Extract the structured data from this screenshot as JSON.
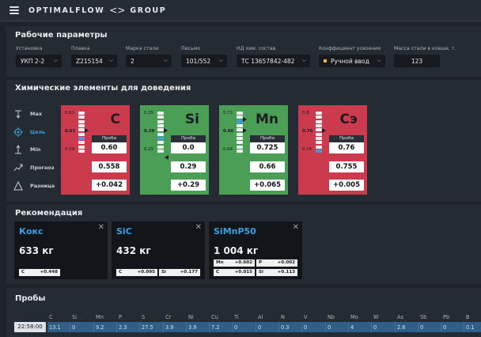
{
  "header": {
    "brand_left": "OPTIMALFLOW",
    "brand_mid": "<>",
    "brand_right": "GROUP"
  },
  "params": {
    "title": "Рабочие параметры",
    "fields": [
      {
        "label": "Установка",
        "value": "УКП 2-2",
        "dropdown": true
      },
      {
        "label": "Плавка",
        "value": "Z215154",
        "dropdown": true
      },
      {
        "label": "Марка стали",
        "value": "2",
        "dropdown": true
      },
      {
        "label": "Письмо",
        "value": "101/552",
        "dropdown": true
      },
      {
        "label": "НД хим. состав",
        "value": "ТС 13657842-482",
        "dropdown": true
      },
      {
        "label": "Коэффициент усвоения",
        "value": "Ручной ввод",
        "dropdown": true
      },
      {
        "label": "Масса стали в ковше, т.",
        "value": "123",
        "dropdown": false
      }
    ]
  },
  "chem": {
    "title": "Химические элементы для доведения",
    "legend": [
      "Max",
      "Цель",
      "Min",
      "Прогноз",
      "Разница"
    ],
    "proba_label": "Проба",
    "cards": [
      {
        "symbol": "C",
        "color": "#cc3a4d",
        "scale_top": "0.62",
        "scale_mid": "0.61",
        "scale_bot": "0.59",
        "proba": "0.60",
        "forecast": "0.558",
        "diff": "+0.042",
        "highlight_index": 6
      },
      {
        "symbol": "Si",
        "color": "#4a9e55",
        "scale_top": "0.35",
        "scale_mid": "0.29",
        "scale_bot": "0.25",
        "proba": "0.0",
        "forecast": "0.29",
        "diff": "+0.29",
        "highlight_index": 6
      },
      {
        "symbol": "Mn",
        "color": "#4a9e55",
        "scale_top": "0.72",
        "scale_mid": "0.66",
        "scale_bot": "0.64",
        "proba": "0.725",
        "forecast": "0.66",
        "diff": "+0.065",
        "highlight_index": 2
      },
      {
        "symbol": "Сэ",
        "color": "#cc3a4d",
        "scale_top": "0.8",
        "scale_mid": "0.76",
        "scale_bot": "0.76",
        "proba": "0.76",
        "forecast": "0.755",
        "diff": "+0.005",
        "highlight_index": 9
      }
    ]
  },
  "recs": {
    "title": "Рекомендация",
    "items": [
      {
        "name": "Кокс",
        "amount": "633 кг",
        "chips": [
          {
            "el": "C",
            "val": "+0.448"
          }
        ]
      },
      {
        "name": "SiC",
        "amount": "432 кг",
        "chips": [
          {
            "el": "C",
            "val": "+0.095"
          },
          {
            "el": "Si",
            "val": "+0.177"
          }
        ]
      },
      {
        "name": "SiMnP50",
        "amount": "1 004 кг",
        "chips": [
          {
            "el": "Mn",
            "val": "+0.602"
          },
          {
            "el": "P",
            "val": "+0.002"
          },
          {
            "el": "C",
            "val": "+0.015"
          },
          {
            "el": "Si",
            "val": "+0.113"
          }
        ]
      }
    ]
  },
  "samples": {
    "title": "Пробы",
    "time": "22:58:00",
    "columns": [
      "C",
      "Si",
      "Mn",
      "P",
      "S",
      "Cr",
      "Ni",
      "Cu",
      "Ti",
      "Al",
      "N",
      "V",
      "Nb",
      "Mo",
      "W",
      "As",
      "Sb",
      "Pb",
      "B"
    ],
    "values": [
      "13.1",
      "0",
      "9.2",
      "2.3",
      "27.5",
      "3.9",
      "3.9",
      "7.2",
      "0",
      "0",
      "0.3",
      "0",
      "0",
      "4",
      "0",
      "2.6",
      "0",
      "0",
      "0.1"
    ]
  },
  "colors": {
    "accent": "#3aa0e2",
    "red": "#cc3a4d",
    "green": "#4a9e55",
    "panel": "#252b32",
    "bg": "#1e2329"
  }
}
